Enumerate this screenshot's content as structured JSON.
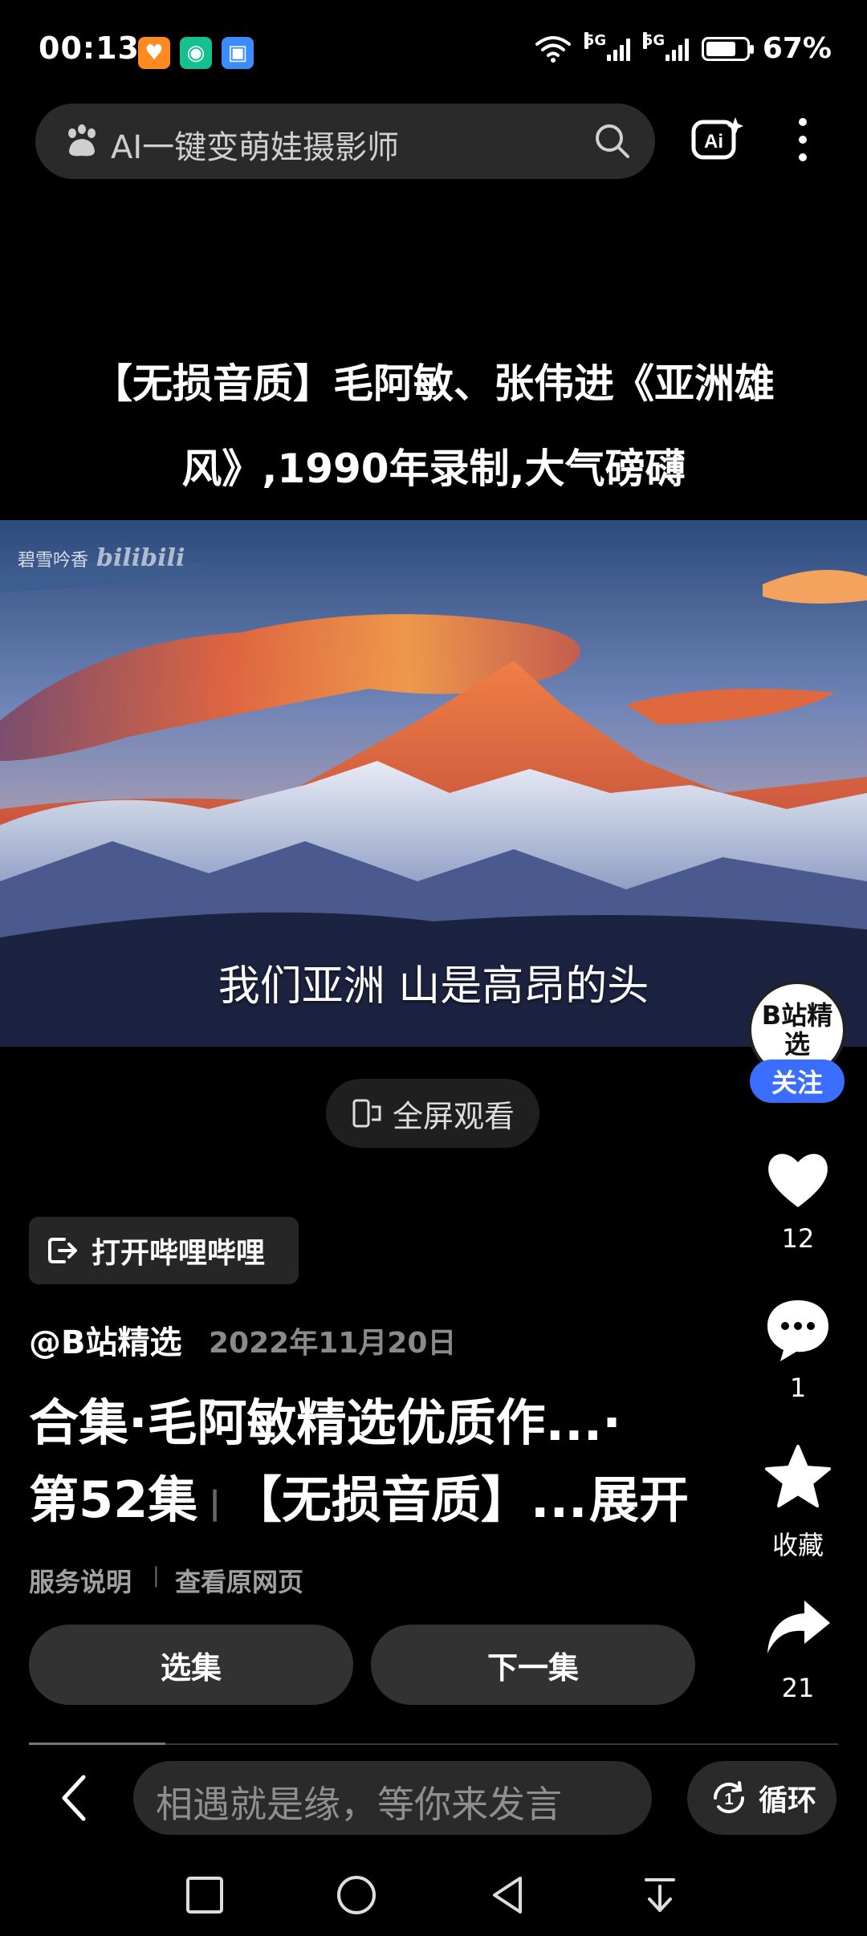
{
  "status_bar": {
    "time": "00:13",
    "signal1": "5G",
    "signal2": "5G",
    "battery": "67%"
  },
  "search": {
    "placeholder": "AI一键变萌娃摄影师",
    "ai_label": "Ai"
  },
  "video": {
    "title": "【无损音质】毛阿敏、张伟进《亚洲雄风》,1990年录制,大气磅礴",
    "watermark_text": "碧雪吟香",
    "watermark_logo": "bilibili",
    "subtitle": "我们亚洲  山是高昂的头",
    "fullscreen_label": "全屏观看"
  },
  "rail": {
    "avatar_text": "B站精选",
    "follow_label": "关注",
    "like_count": "12",
    "comment_count": "1",
    "favorite_label": "收藏",
    "share_count": "21"
  },
  "info": {
    "open_app_label": "打开哔哩哔哩",
    "uploader": "@B站精选",
    "date": "2022年11月20日",
    "desc_line1": "合集·毛阿敏精选优质作...·",
    "desc_line2_a": "第52集",
    "desc_line2_b": "【无损音质】...",
    "expand_label": "展开",
    "service_label": "服务说明",
    "view_original_label": "查看原网页",
    "episodes_label": "选集",
    "next_label": "下一集"
  },
  "bottom": {
    "comment_placeholder": "相遇就是缘，等你来发言",
    "loop_label": "循环"
  },
  "colors": {
    "accent": "#3b6dff",
    "background": "#000000",
    "pill": "#323232"
  }
}
